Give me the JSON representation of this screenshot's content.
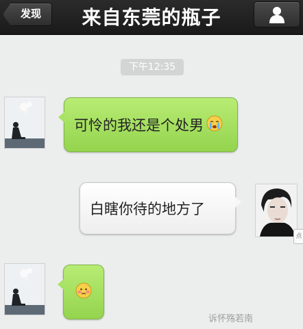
{
  "header": {
    "back_label": "发现",
    "title": "来自东莞的瓶子",
    "profile_icon": "person-icon"
  },
  "timestamp": "下午12:35",
  "messages": [
    {
      "side": "left",
      "text": "可怜的我还是个处男",
      "emoji": "crying-face-emoji"
    },
    {
      "side": "right",
      "text": "白瞎你待的地方了"
    },
    {
      "side": "left",
      "text": "",
      "emoji": "blushing-face-emoji"
    }
  ],
  "side_tag": "点",
  "watermark": "诉怀殇若南",
  "colors": {
    "header_bg": "#1f1f1f",
    "chat_bg": "#eceeed",
    "bubble_green": "#a8e263",
    "bubble_white": "#f7f7f7",
    "timestamp_bg": "#d3d5d4"
  }
}
